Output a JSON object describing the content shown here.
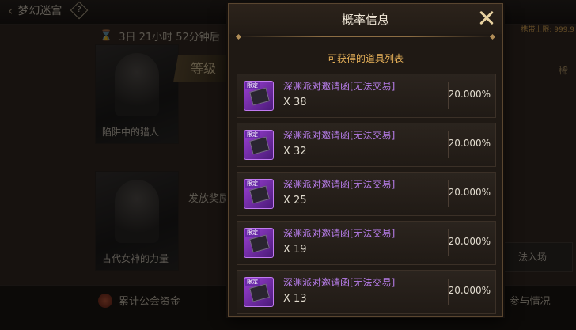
{
  "background": {
    "title": "梦幻迷宫",
    "help_glyph": "?",
    "timer": "3日 21小时 52分钟后",
    "carry_limit": "携带上限: 999,9",
    "rare_label": "稀",
    "level_label": "等级",
    "heroes": [
      {
        "name": "陷阱中的猎人"
      },
      {
        "name": "古代女神的力量"
      }
    ],
    "reward_text": "发放奖励",
    "enter_text": "法入场",
    "guild_funds": "累计公会资金",
    "participation": "参与情况"
  },
  "modal": {
    "title": "概率信息",
    "subtitle": "可获得的道具列表",
    "items": [
      {
        "name": "深渊派对邀请函[无法交易]",
        "quantity": "X 38",
        "rate": "20.000%",
        "tag": "限定"
      },
      {
        "name": "深渊派对邀请函[无法交易]",
        "quantity": "X 32",
        "rate": "20.000%",
        "tag": "限定"
      },
      {
        "name": "深渊派对邀请函[无法交易]",
        "quantity": "X 25",
        "rate": "20.000%",
        "tag": "限定"
      },
      {
        "name": "深渊派对邀请函[无法交易]",
        "quantity": "X 19",
        "rate": "20.000%",
        "tag": "限定"
      },
      {
        "name": "深渊派对邀请函[无法交易]",
        "quantity": "X 13",
        "rate": "20.000%",
        "tag": "限定"
      }
    ]
  },
  "colors": {
    "accent_gold": "#e9b35a",
    "item_name_purple": "#b67ce8",
    "modal_bg": "#1f1914"
  },
  "icons": {
    "close": "close-icon",
    "item": "invitation-card-icon",
    "hourglass": "hourglass-icon",
    "coin": "guild-coin-icon"
  }
}
